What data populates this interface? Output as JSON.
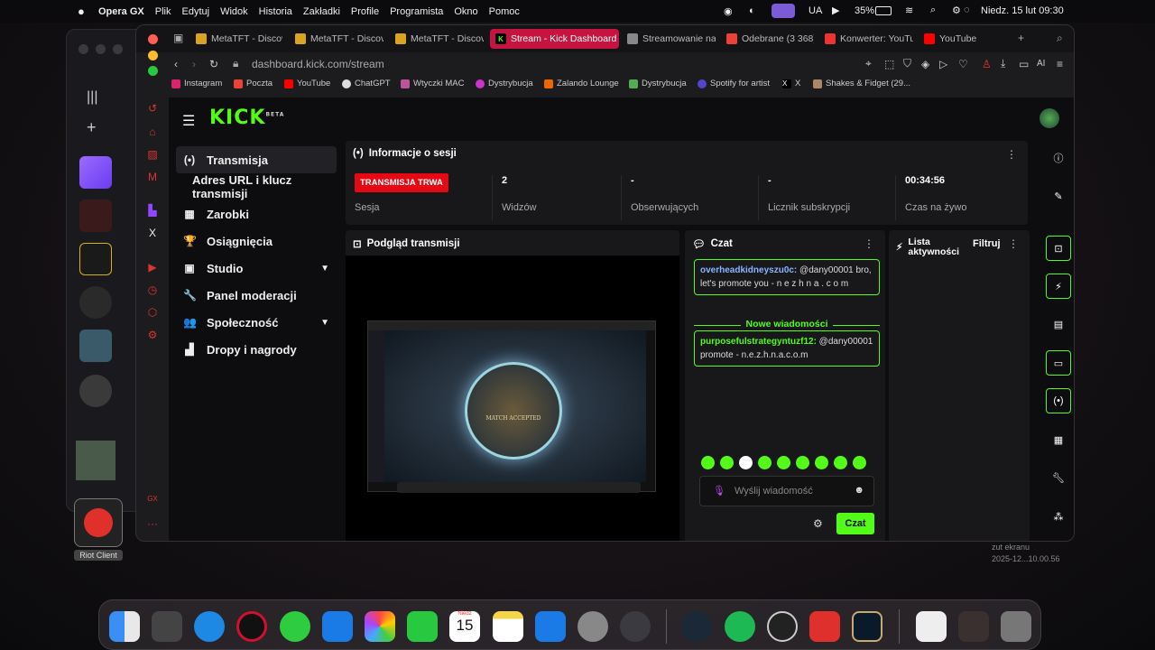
{
  "menubar": {
    "app": "Opera GX",
    "items": [
      "Plik",
      "Edytuj",
      "Widok",
      "Historia",
      "Zakładki",
      "Profile",
      "Programista",
      "Okno",
      "Pomoc"
    ],
    "lang": "UA",
    "battery": "35%",
    "clock": "Niedz. 15 lut  09:30"
  },
  "tabs": [
    {
      "label": "MetaTFT - Discov",
      "color": "#d9a520"
    },
    {
      "label": "MetaTFT - Discov",
      "color": "#d9a520"
    },
    {
      "label": "MetaTFT - Discov",
      "color": "#d9a520"
    },
    {
      "label": "Stream - Kick Dashboard",
      "color": "#53fc18",
      "active": true
    },
    {
      "label": "Streamowanie na",
      "color": "#888"
    },
    {
      "label": "Odebrane (3 368)",
      "color": "#ea4335"
    },
    {
      "label": "Konwerter: YouTu",
      "color": "#e33"
    },
    {
      "label": "YouTube",
      "color": "#f00"
    }
  ],
  "address": {
    "url": "dashboard.kick.com/stream",
    "ai_label": "AI"
  },
  "bookmarks": [
    "Instagram",
    "Poczta",
    "YouTube",
    "ChatGPT",
    "Wtyczki MAC",
    "Dystrybucja",
    "Zalando Lounge",
    "Dystrybucja",
    "Spotify for artist",
    "X",
    "Shakes & Fidget (29..."
  ],
  "kick": {
    "logo": "KICK",
    "logo_sup": "BETA",
    "nav": [
      {
        "label": "Transmisja",
        "icon": "(•)",
        "active": true
      },
      {
        "label": "Adres URL i klucz transmisji",
        "icon": ""
      },
      {
        "label": "Zarobki",
        "icon": "▦"
      },
      {
        "label": "Osiągnięcia",
        "icon": "🏆"
      },
      {
        "label": "Studio",
        "icon": "▣",
        "expand": true
      },
      {
        "label": "Panel moderacji",
        "icon": "🔧"
      },
      {
        "label": "Społeczność",
        "icon": "👥",
        "expand": true
      },
      {
        "label": "Dropy i nagrody",
        "icon": "▟"
      }
    ],
    "session": {
      "title": "Informacje o sesji",
      "badge": "TRANSMISJA TRWA",
      "stats": [
        {
          "value": "",
          "label": "Sesja"
        },
        {
          "value": "2",
          "label": "Widzów"
        },
        {
          "value": "-",
          "label": "Obserwujących"
        },
        {
          "value": "-",
          "label": "Licznik subskrypcji"
        },
        {
          "value": "00:34:56",
          "label": "Czas na żywo"
        }
      ]
    },
    "preview": {
      "title": "Podgląd transmisji",
      "match_text": "MATCH ACCEPTED"
    },
    "chat": {
      "title": "Czat",
      "messages": [
        {
          "user": "overheadkidneyszu0c:",
          "text": " @dany00001 bro, let's promote you - n e z h  n a . c o m",
          "user_color": "#8ab4ff"
        },
        {
          "user": "purposefulstrategyntuzf12:",
          "text": " @dany00001 promote - n.e.z.h.n.a.c.o.m",
          "user_color": "#53fc18"
        }
      ],
      "new_messages": "Nowe wiadomości",
      "input_placeholder": "Wyślij wiadomość",
      "send_label": "Czat"
    },
    "activity": {
      "title": "Lista aktywności",
      "filter": "Filtruj"
    }
  },
  "dock": {
    "calendar_day": "15",
    "calendar_month": "Niedz",
    "riot_label": "Riot Client"
  },
  "screenshot_label": {
    "line1": "zut ekranu",
    "line2": "2025-12...10.00.56"
  }
}
